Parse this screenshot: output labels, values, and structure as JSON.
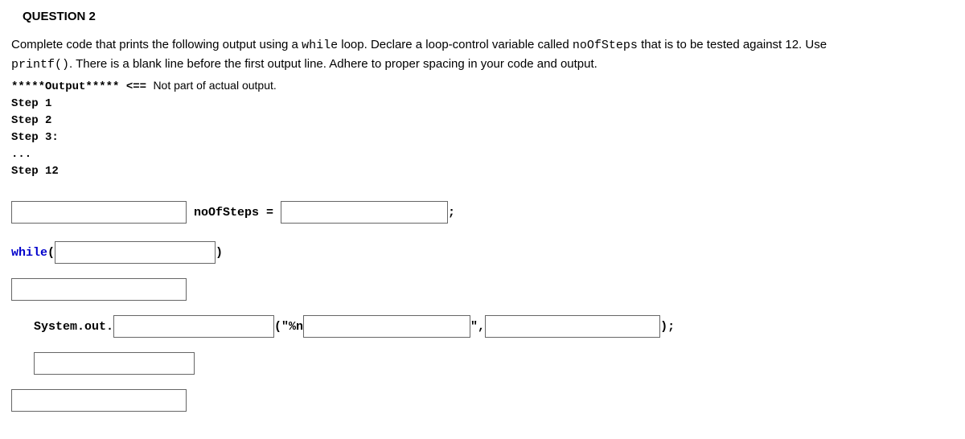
{
  "heading": "QUESTION 2",
  "instructions": {
    "part1": "Complete code that prints the following output using a ",
    "code1": "while",
    "part2": " loop.  Declare a loop-control variable called ",
    "code2": "noOfSteps",
    "part3": " that is to be tested against 12.  Use ",
    "code3": "printf()",
    "part4": ". There is a blank line before the first output line.  Adhere to proper spacing in your code and output."
  },
  "output": {
    "header_stars": "*****Output*****",
    "header_arrow": " <== ",
    "header_note": "Not part of actual output.",
    "line1": "Step 1",
    "line2": "Step 2",
    "line3": "Step 3:",
    "line4": "...",
    "line5": "Step 12"
  },
  "code": {
    "noofsteps": " noOfSteps = ",
    "semicolon": ";",
    "while_kw": "while",
    "open_paren": "(",
    "close_paren": ")",
    "system_out": "System.out.",
    "printf_open": "(\"%n",
    "printf_mid": "\",",
    "printf_end": ");"
  }
}
